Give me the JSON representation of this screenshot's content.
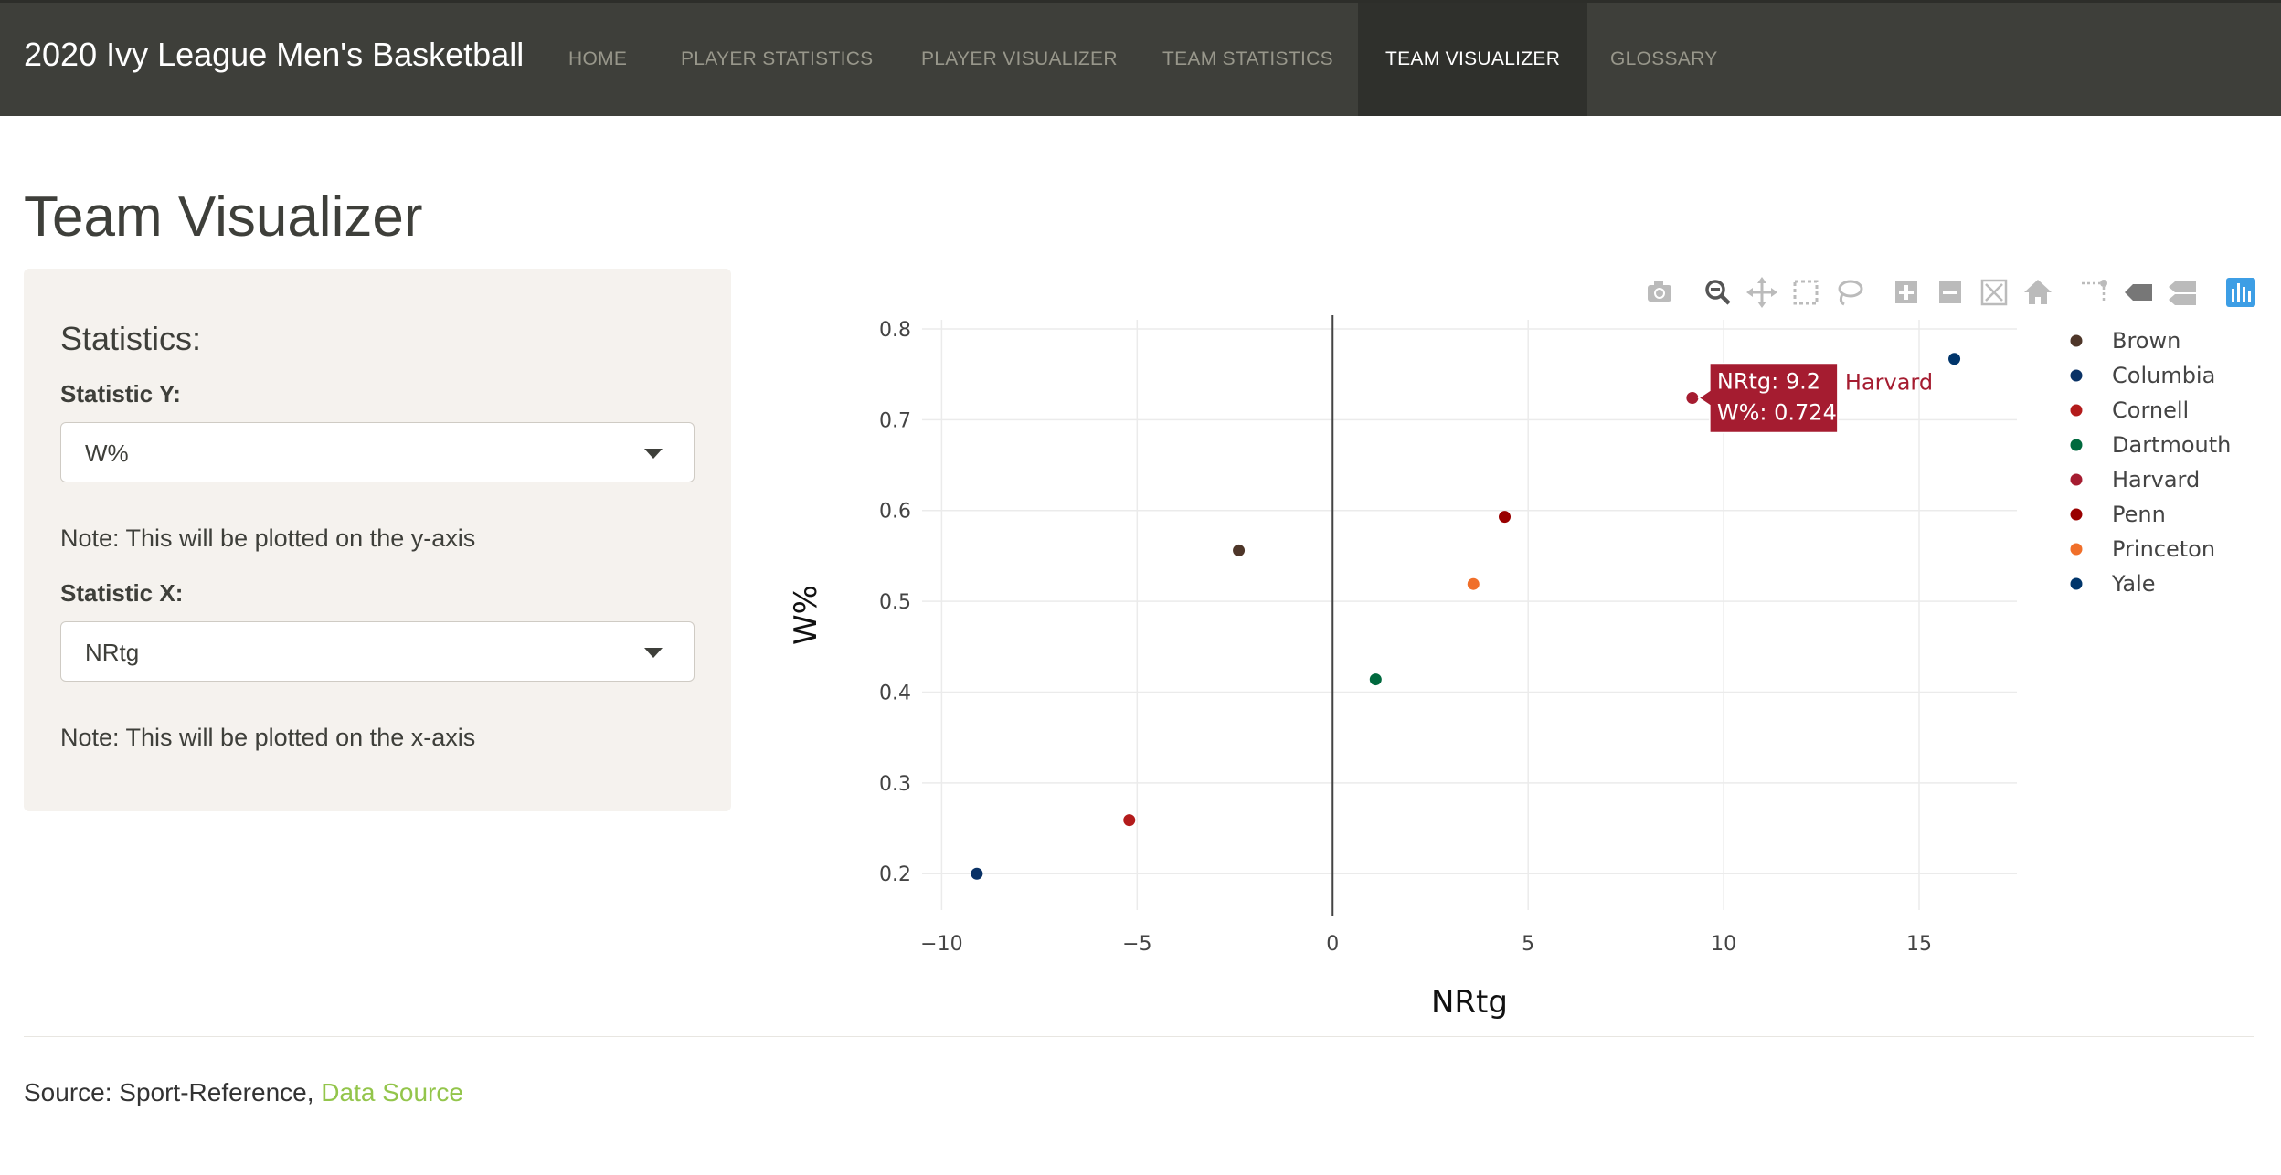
{
  "navbar": {
    "brand": "2020 Ivy League Men's Basketball",
    "items": [
      {
        "label": "HOME",
        "active": false
      },
      {
        "label": "PLAYER STATISTICS",
        "active": false
      },
      {
        "label": "PLAYER VISUALIZER",
        "active": false
      },
      {
        "label": "TEAM STATISTICS",
        "active": false
      },
      {
        "label": "TEAM VISUALIZER",
        "active": true
      },
      {
        "label": "GLOSSARY",
        "active": false
      }
    ]
  },
  "page": {
    "title": "Team Visualizer"
  },
  "sidebar": {
    "heading": "Statistics:",
    "stat_y": {
      "label": "Statistic Y:",
      "value": "W%",
      "note": "Note: This will be plotted on the y-axis"
    },
    "stat_x": {
      "label": "Statistic X:",
      "value": "NRtg",
      "note": "Note: This will be plotted on the x-axis"
    }
  },
  "modebar": {
    "icons": [
      "camera-icon",
      "zoom-icon",
      "pan-icon",
      "box-select-icon",
      "lasso-icon",
      "zoom-in-icon",
      "zoom-out-icon",
      "autoscale-icon",
      "reset-axes-icon",
      "spike-lines-icon",
      "hover-closest-icon",
      "hover-compare-icon",
      "plotly-logo-icon"
    ],
    "active_icon": "zoom-icon"
  },
  "chart_data": {
    "type": "scatter",
    "xlabel": "NRtg",
    "ylabel": "W%",
    "xlim": [
      -10.5,
      17.5
    ],
    "ylim": [
      0.16,
      0.81
    ],
    "xticks": [
      -10,
      -5,
      0,
      5,
      10,
      15
    ],
    "yticks": [
      0.2,
      0.3,
      0.4,
      0.5,
      0.6,
      0.7,
      0.8
    ],
    "xtick_labels": [
      "−10",
      "−5",
      "0",
      "5",
      "10",
      "15"
    ],
    "ytick_labels": [
      "0.2",
      "0.3",
      "0.4",
      "0.5",
      "0.6",
      "0.7",
      "0.8"
    ],
    "grid": true,
    "zero_line_x": true,
    "legend_position": "right",
    "series": [
      {
        "name": "Brown",
        "color": "#4e3629",
        "x": [
          -2.4
        ],
        "y": [
          0.556
        ]
      },
      {
        "name": "Columbia",
        "color": "#0a3266",
        "x": [
          -9.1
        ],
        "y": [
          0.2
        ]
      },
      {
        "name": "Cornell",
        "color": "#b31b1b",
        "x": [
          -5.2
        ],
        "y": [
          0.259
        ]
      },
      {
        "name": "Dartmouth",
        "color": "#00693e",
        "x": [
          1.1
        ],
        "y": [
          0.414
        ]
      },
      {
        "name": "Harvard",
        "color": "#a51c30",
        "x": [
          9.2
        ],
        "y": [
          0.724
        ]
      },
      {
        "name": "Penn",
        "color": "#990000",
        "x": [
          4.4
        ],
        "y": [
          0.593
        ]
      },
      {
        "name": "Princeton",
        "color": "#f06f2a",
        "x": [
          3.6
        ],
        "y": [
          0.519
        ]
      },
      {
        "name": "Yale",
        "color": "#00356b",
        "x": [
          15.9
        ],
        "y": [
          0.767
        ]
      }
    ],
    "hover": {
      "series": "Harvard",
      "lines": [
        "NRtg: 9.2",
        "W%: 0.724"
      ],
      "name": "Harvard"
    }
  },
  "footer": {
    "source_prefix": "Source: Sport-Reference,",
    "link_label": "Data Source"
  }
}
